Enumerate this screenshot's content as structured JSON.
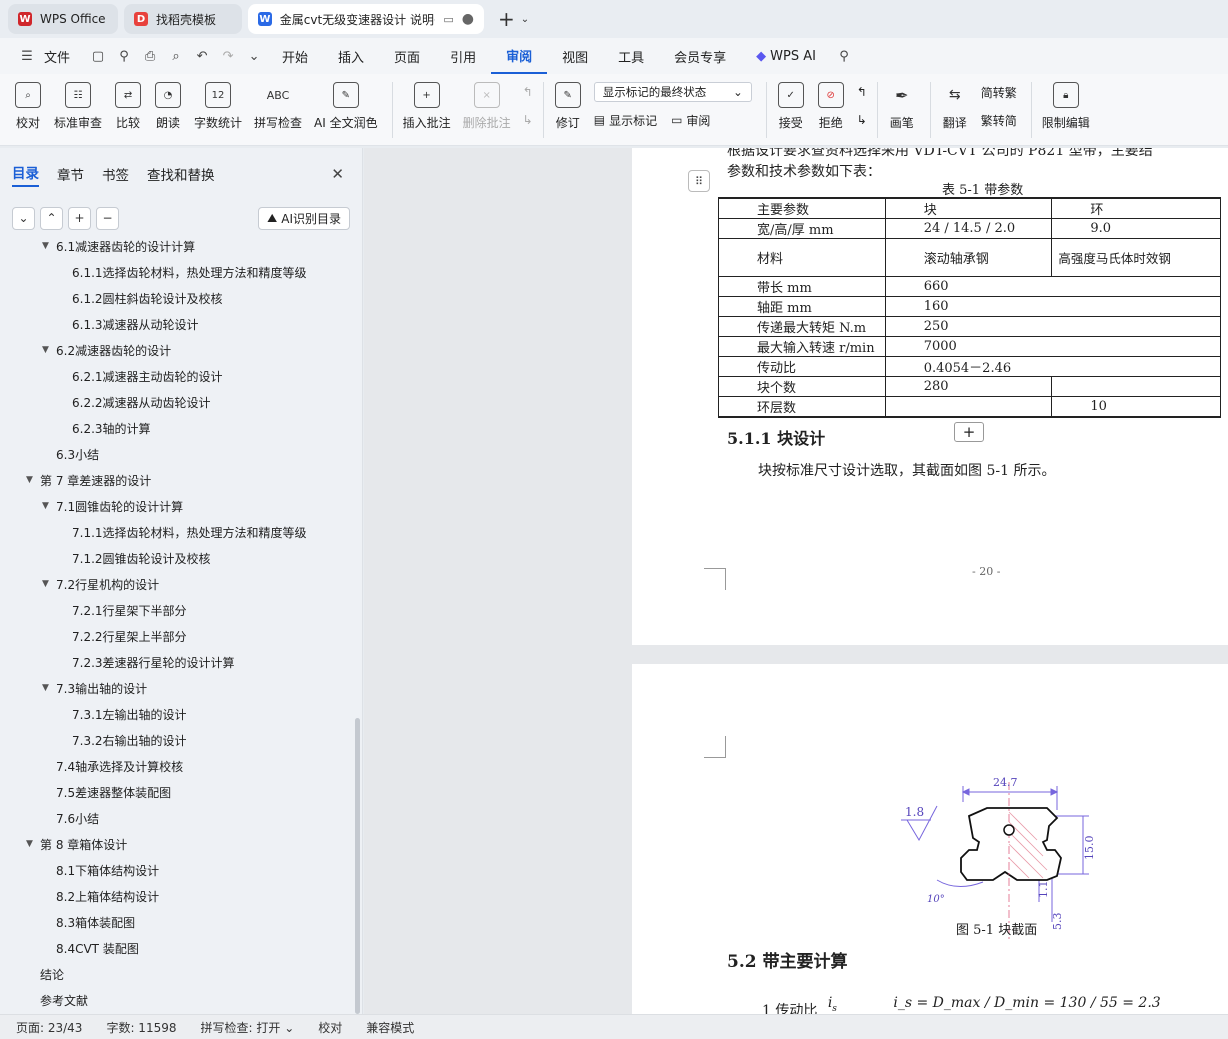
{
  "tabs": [
    {
      "label": "WPS Office",
      "color": "#d0262b",
      "mark": "W"
    },
    {
      "label": "找稻壳模板",
      "color": "#e8413c",
      "mark": "D"
    },
    {
      "label": "金属cvt无级变速器设计 说明书",
      "color": "#2b6ae6",
      "mark": "W"
    }
  ],
  "menu": {
    "file": "文件",
    "items": [
      "开始",
      "插入",
      "页面",
      "引用",
      "审阅",
      "视图",
      "工具",
      "会员专享"
    ],
    "active": "审阅",
    "wps_ai": "WPS AI"
  },
  "ribbon": {
    "proofread": "校对",
    "standard_review": "标准审查",
    "compare": "比较",
    "read_aloud": "朗读",
    "word_count": "字数统计",
    "word_count_icon_text": "12",
    "spell_check": "拼写检查",
    "spell_icon_text": "ABC",
    "ai_polish": "AI 全文润色",
    "insert_comment": "插入批注",
    "delete_comment": "删除批注",
    "track_changes": "修订",
    "markup_state": "显示标记的最终状态",
    "show_markup": "显示标记",
    "review_pane": "审阅",
    "accept": "接受",
    "reject": "拒绝",
    "pen": "画笔",
    "translate": "翻译",
    "to_traditional": "简转繁",
    "to_simplified": "繁转简",
    "restrict_edit": "限制编辑"
  },
  "sidebar": {
    "tabs": [
      "目录",
      "章节",
      "书签",
      "查找和替换"
    ],
    "active_tab": "目录",
    "ai_toc": "AI识别目录",
    "toc": [
      {
        "level": 2,
        "text": "6.1减速器齿轮的设计计算",
        "expanded": true
      },
      {
        "level": 3,
        "text": "6.1.1选择齿轮材料，热处理方法和精度等级"
      },
      {
        "level": 3,
        "text": "6.1.2圆柱斜齿轮设计及校核"
      },
      {
        "level": 3,
        "text": "6.1.3减速器从动轮设计"
      },
      {
        "level": 2,
        "text": "6.2减速器齿轮的设计",
        "expanded": true
      },
      {
        "level": 3,
        "text": "6.2.1减速器主动齿轮的设计"
      },
      {
        "level": 3,
        "text": "6.2.2减速器从动齿轮设计"
      },
      {
        "level": 3,
        "text": "6.2.3轴的计算"
      },
      {
        "level": 2,
        "text": "6.3小结"
      },
      {
        "level": 1,
        "text": "第 7 章差速器的设计",
        "expanded": true
      },
      {
        "level": 2,
        "text": "7.1圆锥齿轮的设计计算",
        "expanded": true
      },
      {
        "level": 3,
        "text": "7.1.1选择齿轮材料，热处理方法和精度等级"
      },
      {
        "level": 3,
        "text": "7.1.2圆锥齿轮设计及校核"
      },
      {
        "level": 2,
        "text": "7.2行星机构的设计",
        "expanded": true
      },
      {
        "level": 3,
        "text": "7.2.1行星架下半部分"
      },
      {
        "level": 3,
        "text": "7.2.2行星架上半部分"
      },
      {
        "level": 3,
        "text": "7.2.3差速器行星轮的设计计算"
      },
      {
        "level": 2,
        "text": "7.3输出轴的设计",
        "expanded": true
      },
      {
        "level": 3,
        "text": "7.3.1左输出轴的设计"
      },
      {
        "level": 3,
        "text": "7.3.2右输出轴的设计"
      },
      {
        "level": 2,
        "text": "7.4轴承选择及计算校核"
      },
      {
        "level": 2,
        "text": "7.5差速器整体装配图"
      },
      {
        "level": 2,
        "text": "7.6小结"
      },
      {
        "level": 1,
        "text": "第 8 章箱体设计",
        "expanded": true
      },
      {
        "level": 2,
        "text": "8.1下箱体结构设计"
      },
      {
        "level": 2,
        "text": "8.2上箱体结构设计"
      },
      {
        "level": 2,
        "text": "8.3箱体装配图"
      },
      {
        "level": 2,
        "text": "8.4CVT 装配图"
      },
      {
        "level": 1,
        "text": "结论"
      },
      {
        "level": 1,
        "text": "参考文献"
      }
    ]
  },
  "document": {
    "intro_line1": "根据设计要求查资料选择采用 VDT-CVT 公司的 P821 型带，主要结",
    "intro_line2": "参数和技术参数如下表：",
    "table_caption": "表 5-1 带参数",
    "table": [
      [
        "主要参数",
        "块",
        "环"
      ],
      [
        "宽/高/厚 mm",
        "24 / 14.5 / 2.0",
        "9.0"
      ],
      [
        "材料",
        "滚动轴承钢",
        "高强度马氏体时效钢"
      ],
      [
        "带长 mm",
        "660",
        ""
      ],
      [
        "轴距 mm",
        "160",
        ""
      ],
      [
        "传递最大转矩 N.m",
        "250",
        ""
      ],
      [
        "最大输入转速 r/min",
        "7000",
        ""
      ],
      [
        "传动比",
        "0.4054－2.46",
        ""
      ],
      [
        "块个数",
        "280",
        ""
      ],
      [
        "环层数",
        "",
        "10"
      ]
    ],
    "section_511": "5.1.1  块设计",
    "para_511": "块按标准尺寸设计选取，其截面如图 5-1 所示。",
    "page_number": "- 20 -",
    "fig": {
      "dim_top": "24.7",
      "dim_rough": "1.8",
      "dim_height": "15.0",
      "dim_mid": "1.1",
      "dim_bottom": "5.3",
      "dim_angle": "10°"
    },
    "fig_caption": "图 5-1   块截面",
    "section_52": "5.2  带主要计算",
    "calc_label": "1  传动比",
    "calc_symbol": "i",
    "calc_sub": "s",
    "calc_formula": "i_s = D_max / D_min = 130 / 55 = 2.3"
  },
  "status": {
    "page": "页面: 23/43",
    "words": "字数: 11598",
    "spell": "拼写检查: 打开",
    "proof": "校对",
    "compat": "兼容模式"
  }
}
